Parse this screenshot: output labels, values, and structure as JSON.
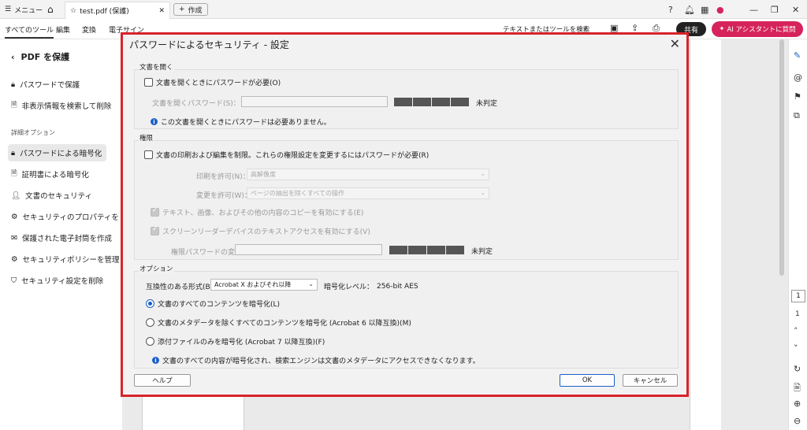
{
  "titlebar": {
    "menu_label": "メニュー",
    "tab_title": "test.pdf (保護)",
    "new_tab_label": "作成"
  },
  "toolbar": {
    "tabs": [
      "すべてのツール",
      "編集",
      "変換",
      "電子サイン"
    ],
    "search_placeholder": "テキストまたはツールを検索",
    "share_label": "共有",
    "ai_label": "AI アシスタントに質問"
  },
  "left_panel": {
    "title": "PDF を保護",
    "items_top": [
      "パスワードで保護",
      "非表示情報を検索して削除"
    ],
    "section_label": "詳細オプション",
    "items_advanced": [
      "パスワードによる暗号化",
      "証明書による暗号化",
      "文書のセキュリティ",
      "セキュリティのプロパティを",
      "保護された電子封筒を作成",
      "セキュリティポリシーを管理",
      "セキュリティ設定を削除"
    ]
  },
  "right_rail": {
    "page_current": "1",
    "page_total": "1"
  },
  "dialog": {
    "title": "パスワードによるセキュリティ - 設定",
    "open_group": {
      "label": "文書を開く",
      "require_password_label": "文書を開くときにパスワードが必要(O)",
      "open_password_label": "文書を開くパスワード(S)：",
      "strength_label": "未判定",
      "info_text": "この文書を開くときにパスワードは必要ありません。"
    },
    "perm_group": {
      "label": "権限",
      "restrict_label": "文書の印刷および編集を制限。これらの権限設定を変更するにはパスワードが必要(R)",
      "print_label": "印刷を許可(N)：",
      "print_value": "高解像度",
      "change_label": "変更を許可(W)：",
      "change_value": "ページの抽出を除くすべての操作",
      "copy_label": "テキスト、画像、およびその他の内容のコピーを有効にする(E)",
      "screenreader_label": "スクリーンリーダーデバイスのテキストアクセスを有効にする(V)",
      "perm_password_label": "権限パスワードの変更(P)：",
      "strength_label": "未判定"
    },
    "options_group": {
      "label": "オプション",
      "compat_label": "互換性のある形式(B)：",
      "compat_value": "Acrobat X およびそれ以降",
      "enc_level_label": "暗号化レベル：",
      "enc_level_value": "256-bit AES",
      "radio_all": "文書のすべてのコンテンツを暗号化(L)",
      "radio_except_meta": "文書のメタデータを除くすべてのコンテンツを暗号化 (Acrobat 6 以降互換)(M)",
      "radio_attachments": "添付ファイルのみを暗号化 (Acrobat 7 以降互換)(F)",
      "info_text": "文書のすべての内容が暗号化され、検索エンジンは文書のメタデータにアクセスできなくなります。"
    },
    "help_label": "ヘルプ",
    "ok_label": "OK",
    "cancel_label": "キャンセル"
  }
}
